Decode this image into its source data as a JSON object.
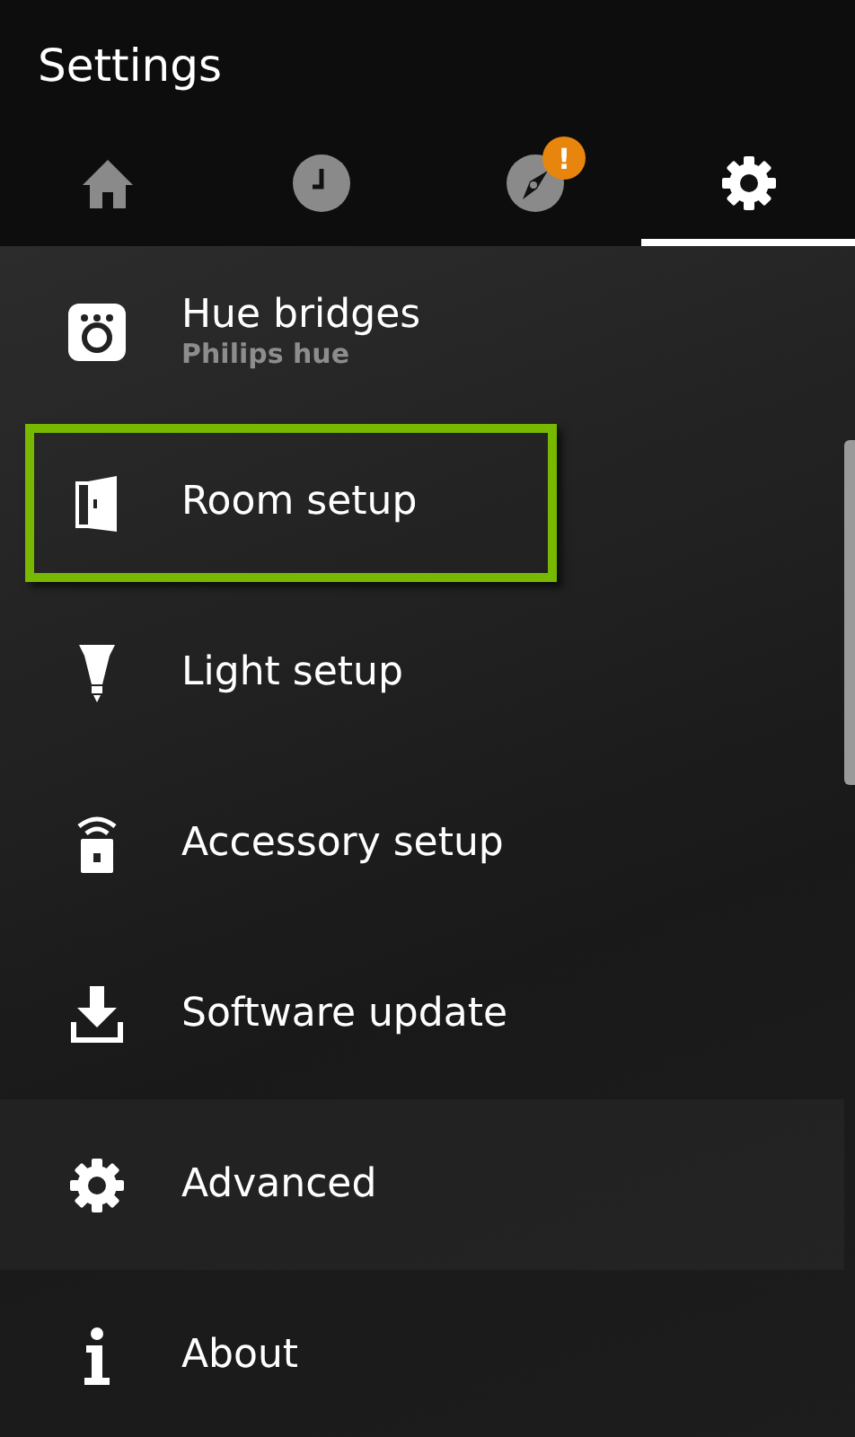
{
  "header": {
    "title": "Settings"
  },
  "tabs": [
    {
      "selected": false
    },
    {
      "selected": false
    },
    {
      "selected": false,
      "badge": "!"
    },
    {
      "selected": true
    }
  ],
  "items": [
    {
      "label": "Hue bridges",
      "subtitle": "Philips hue",
      "highlighted": false
    },
    {
      "label": "Room setup",
      "highlighted": true
    },
    {
      "label": "Light setup",
      "highlighted": false
    },
    {
      "label": "Accessory setup",
      "highlighted": false
    },
    {
      "label": "Software update",
      "highlighted": false
    },
    {
      "label": "Advanced",
      "highlighted": false
    },
    {
      "label": "About",
      "highlighted": false
    }
  ]
}
